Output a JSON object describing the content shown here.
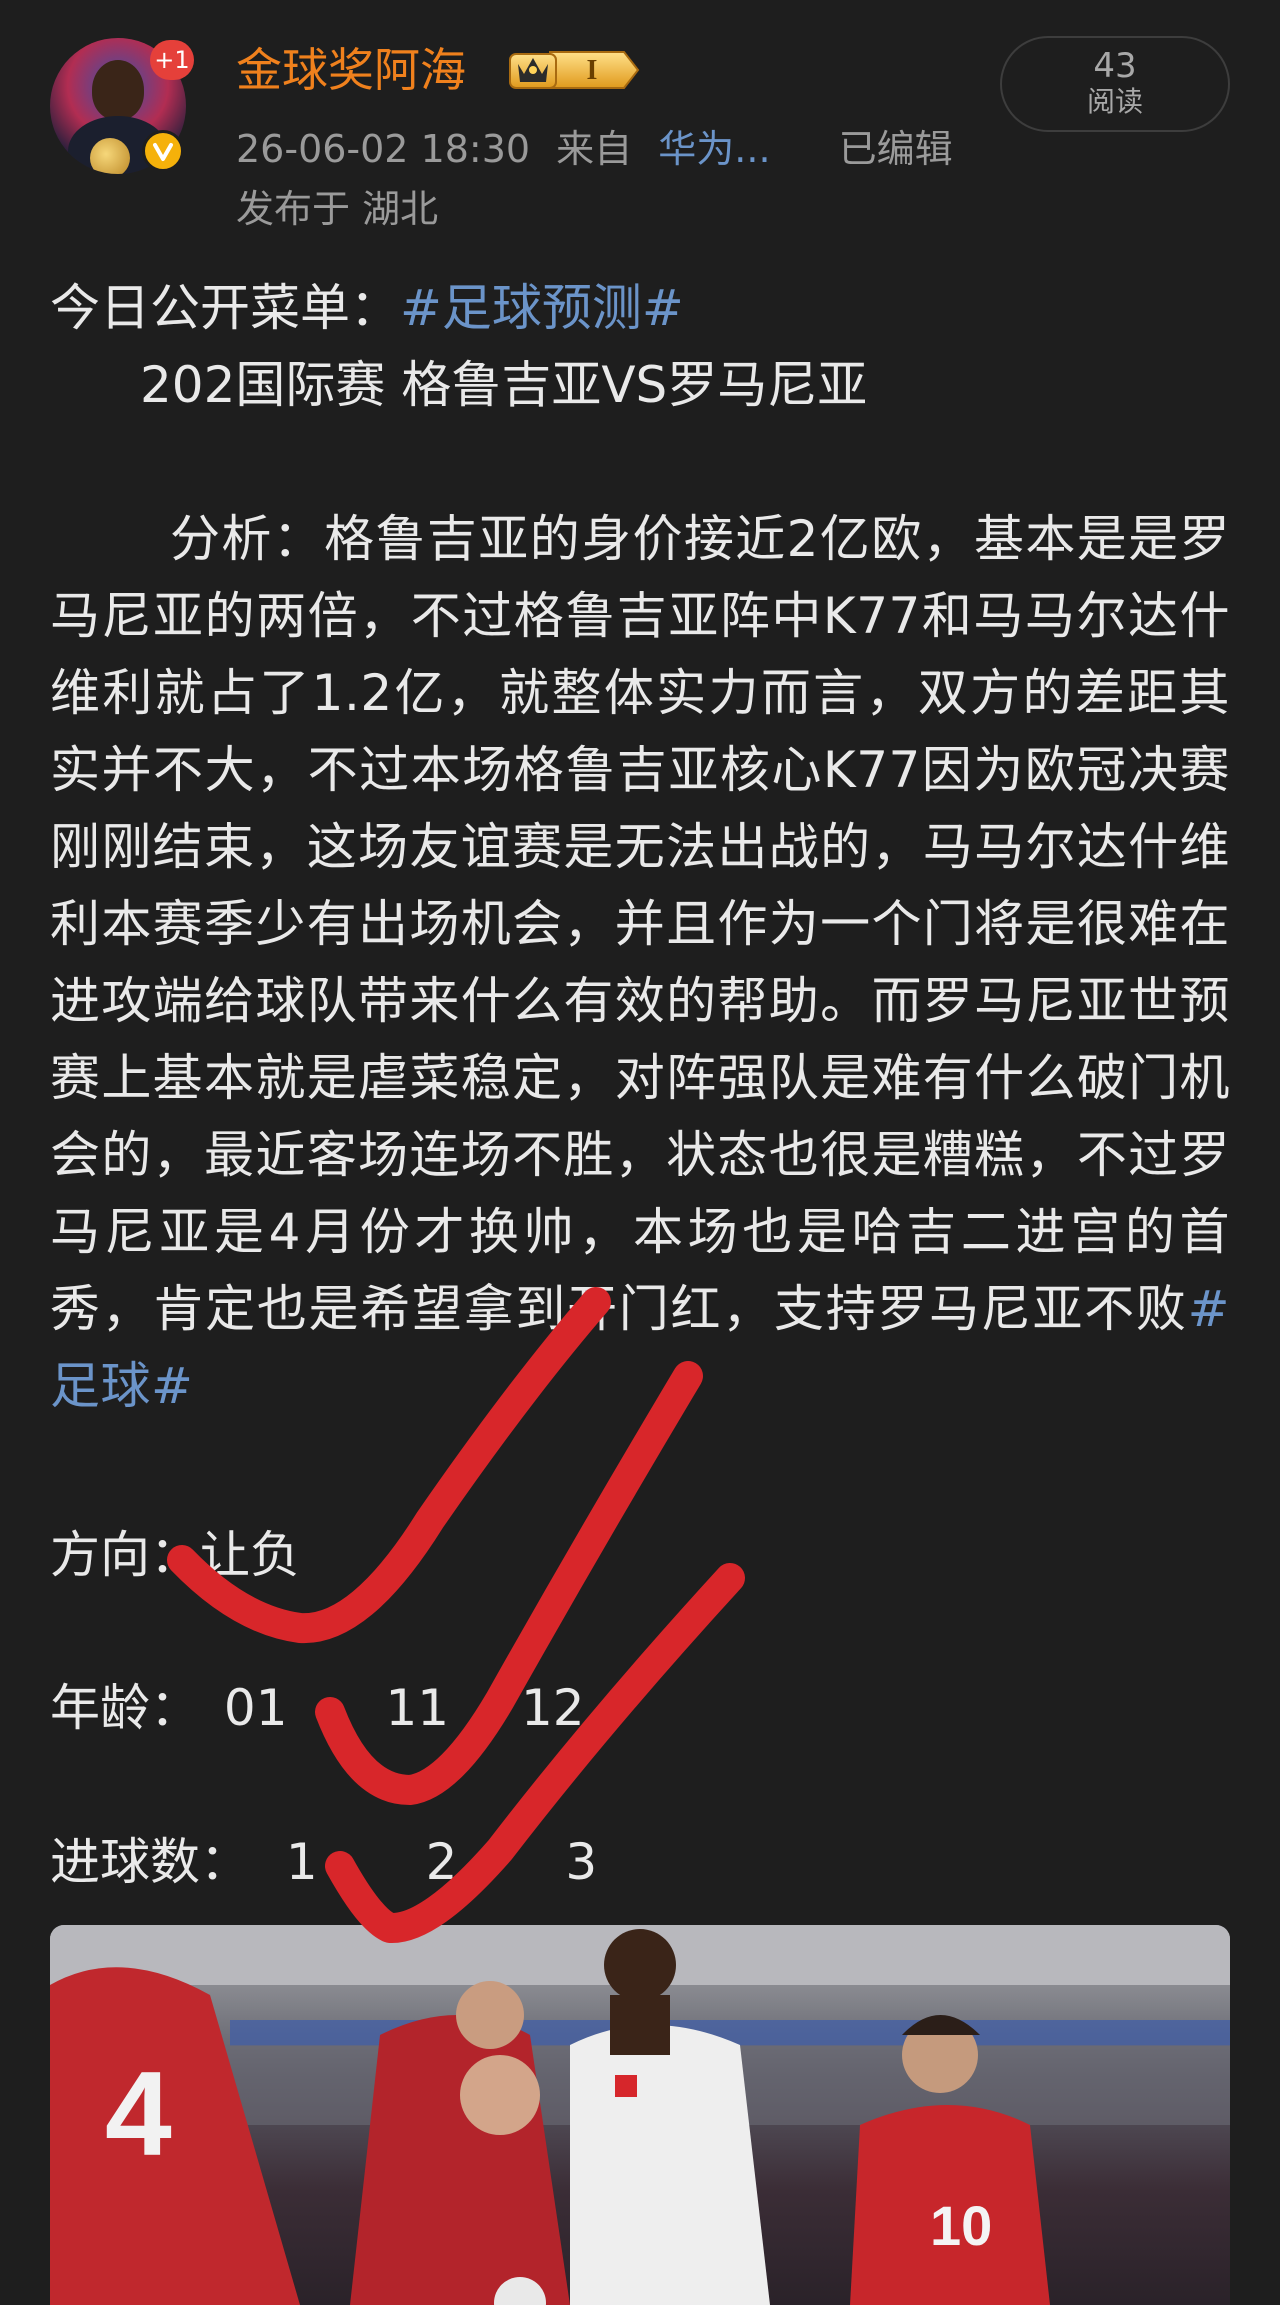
{
  "header": {
    "username": "金球奖阿海",
    "notification_count": "+1",
    "vip_level": "I",
    "timestamp": "26-06-02 18:30",
    "source_prefix": "来自",
    "source_name": "华为...",
    "edited_label": "已编辑",
    "location": "发布于 湖北",
    "read_count": "43",
    "read_label": "阅读"
  },
  "post": {
    "intro_label": "今日公开菜单：",
    "intro_topic": "#足球预测#",
    "match_line": "202国际赛 格鲁吉亚VS罗马尼亚",
    "analysis": "分析：格鲁吉亚的身价接近2亿欧，基本是是罗马尼亚的两倍，不过格鲁吉亚阵中K77和马马尔达什维利就占了1.2亿，就整体实力而言，双方的差距其实并不大，不过本场格鲁吉亚核心K77因为欧冠决赛刚刚结束，这场友谊赛是无法出战的，马马尔达什维利本赛季少有出场机会，并且作为一个门将是很难在进攻端给球队带来什么有效的帮助。而罗马尼亚世预赛上基本就是虐菜稳定，对阵强队是难有什么破门机会的，最近客场连场不胜，状态也很是糟糕，不过罗马尼亚是4月份才换帅，本场也是哈吉二进宫的首秀，肯定也是希望拿到开门红，支持罗马尼亚不败",
    "analysis_topic": "#足球#",
    "direction_label": "方向：",
    "direction_value": "让负",
    "age_label": "年龄：",
    "age_options": [
      "01",
      "11",
      "12"
    ],
    "goals_label": "进球数：",
    "goals_options": [
      "1",
      "2",
      "3"
    ]
  },
  "colors": {
    "background": "#1e1e1e",
    "username": "#f0811d",
    "topic_link": "#6b94c9",
    "check_mark": "#d8262a",
    "notification": "#e5403a"
  },
  "icons": {
    "verify": "verified-v-icon",
    "vip": "crown-level-badge-icon"
  }
}
